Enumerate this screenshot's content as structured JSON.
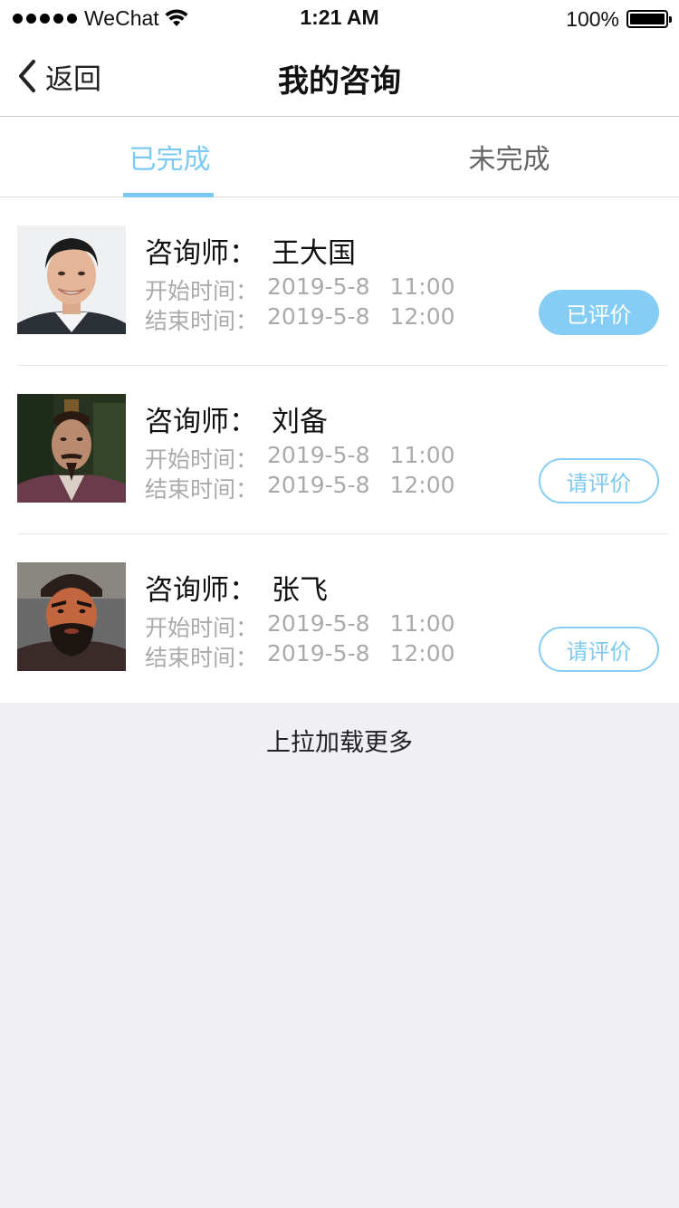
{
  "status_bar": {
    "carrier": "WeChat",
    "time": "1:21 AM",
    "battery": "100%"
  },
  "nav": {
    "back_label": "返回",
    "title": "我的咨询"
  },
  "tabs": [
    {
      "label": "已完成",
      "active": true
    },
    {
      "label": "未完成",
      "active": false
    }
  ],
  "consultations": [
    {
      "consultant_label": "咨询师：",
      "consultant_name": "王大国",
      "start_label": "开始时间：",
      "start_date": "2019-5-8",
      "start_time": "11:00",
      "end_label": "结束时间：",
      "end_date": "2019-5-8",
      "end_time": "12:00",
      "action_label": "已评价",
      "action_style": "filled"
    },
    {
      "consultant_label": "咨询师：",
      "consultant_name": "刘备",
      "start_label": "开始时间：",
      "start_date": "2019-5-8",
      "start_time": "11:00",
      "end_label": "结束时间：",
      "end_date": "2019-5-8",
      "end_time": "12:00",
      "action_label": "请评价",
      "action_style": "outline"
    },
    {
      "consultant_label": "咨询师：",
      "consultant_name": "张飞",
      "start_label": "开始时间：",
      "start_date": "2019-5-8",
      "start_time": "11:00",
      "end_label": "结束时间：",
      "end_date": "2019-5-8",
      "end_time": "12:00",
      "action_label": "请评价",
      "action_style": "outline"
    }
  ],
  "load_more": "上拉加载更多",
  "colors": {
    "accent": "#7cc9f2",
    "background": "#efeff4",
    "muted_text": "#aaaaaa"
  }
}
